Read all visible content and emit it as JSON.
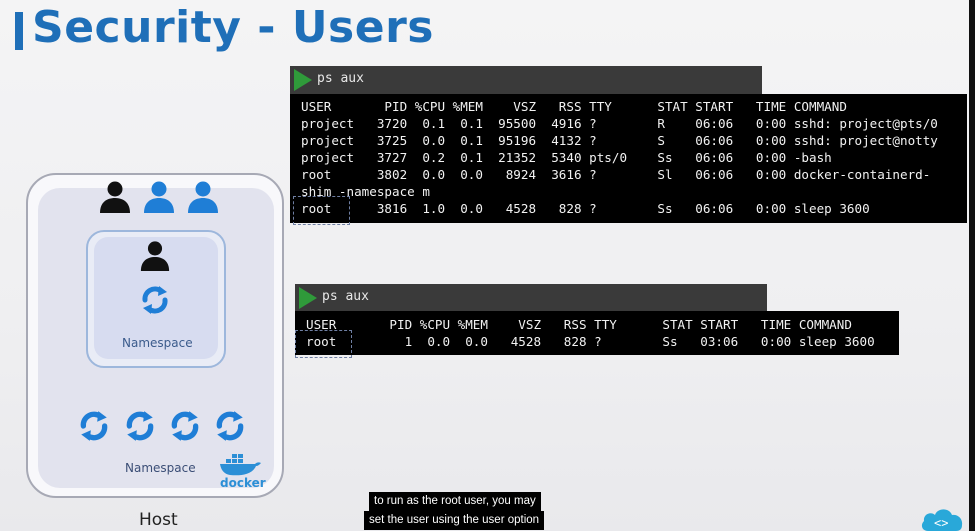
{
  "slide": {
    "title": "Security - Users",
    "accent_color": "#1f6fb8"
  },
  "diagram": {
    "host_label": "Host",
    "namespace_inner_label": "Namespace",
    "namespace_outer_label": "Namespace",
    "docker_label": "docker",
    "user_icons": [
      "person-icon-black",
      "person-icon-blue",
      "person-icon-blue"
    ],
    "process_icons": [
      "sync-icon",
      "sync-icon",
      "sync-icon",
      "sync-icon",
      "sync-icon"
    ]
  },
  "terminal_host": {
    "command": "ps aux",
    "lines": [
      "USER       PID %CPU %MEM    VSZ   RSS TTY      STAT START   TIME COMMAND",
      "project   3720  0.1  0.1  95500  4916 ?        R    06:06   0:00 sshd: project@pts/0",
      "project   3725  0.0  0.1  95196  4132 ?        S    06:06   0:00 sshd: project@notty",
      "project   3727  0.2  0.1  21352  5340 pts/0    Ss   06:06   0:00 -bash",
      "root      3802  0.0  0.0   8924  3616 ?        Sl   06:06   0:00 docker-containerd-",
      "shim -namespace m",
      "root      3816  1.0  0.0   4528   828 ?        Ss   06:06   0:00 sleep 3600"
    ]
  },
  "terminal_container": {
    "command": "ps aux",
    "lines": [
      "USER       PID %CPU %MEM    VSZ   RSS TTY      STAT START   TIME COMMAND",
      "root         1  0.0  0.0   4528   828 ?        Ss   03:06   0:00 sleep 3600"
    ]
  },
  "caption": {
    "line1": "to run as the root user, you may",
    "line2": "set the user using the user option"
  }
}
